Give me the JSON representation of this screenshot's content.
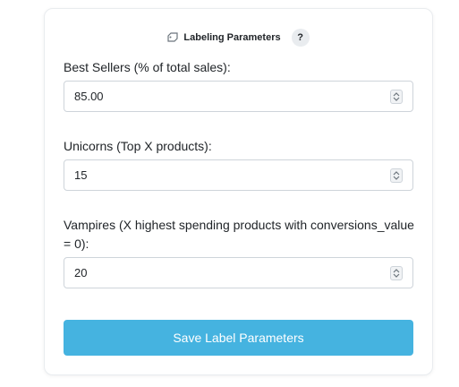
{
  "header": {
    "title": "Labeling Parameters",
    "icon": "tag-icon",
    "help_label": "?"
  },
  "fields": [
    {
      "label": "Best Sellers (% of total sales):",
      "value": "85.00"
    },
    {
      "label": "Unicorns (Top X products):",
      "value": "15"
    },
    {
      "label": "Vampires (X highest spending products with conversions_value = 0):",
      "value": "20"
    }
  ],
  "save_button": {
    "label": "Save Label Parameters"
  },
  "colors": {
    "accent": "#45b3e0",
    "border": "#ced4da",
    "text": "#212529"
  }
}
